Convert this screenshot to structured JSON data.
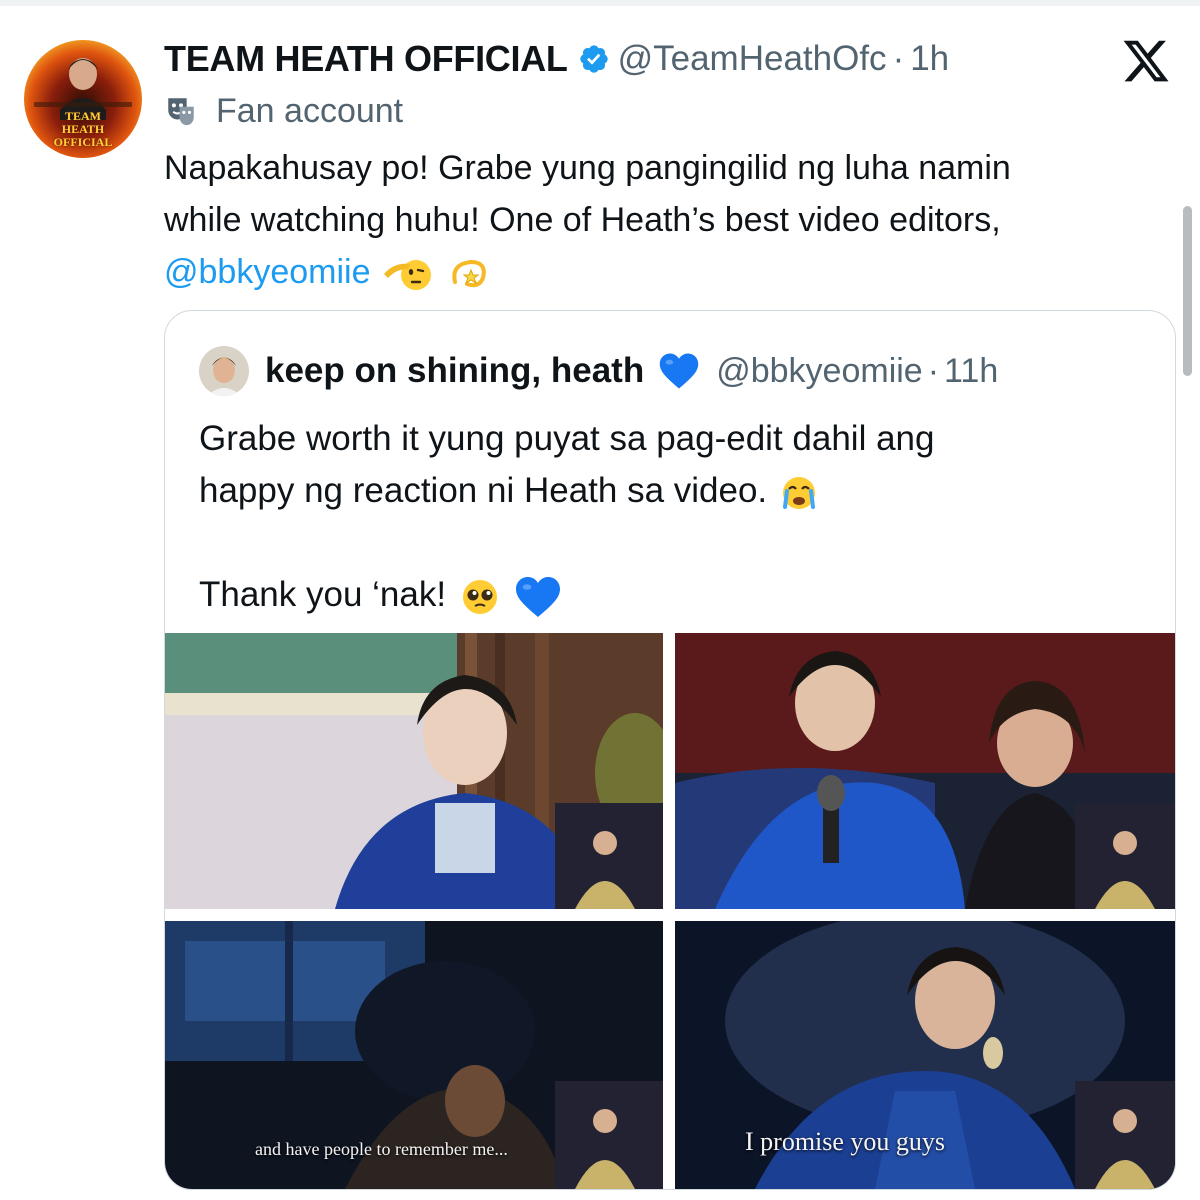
{
  "tweet": {
    "display_name": "TEAM HEATH OFFICIAL",
    "handle": "@TeamHeathOfc",
    "separator": "·",
    "time": "1h",
    "account_label": "Fan account",
    "avatar_text": "TEAM HEATH OFFICIAL",
    "text_lines": [
      "Napakahusay po! Grabe yung pangingilid ng luha namin",
      "while watching huhu! One of Heath’s best video editors,"
    ],
    "mention": "@bbkyeomiie",
    "icons": [
      "verified-badge-icon",
      "fan-account-mask-icon",
      "x-logo-icon",
      "saluting-face-emoji",
      "dizzy-emoji"
    ]
  },
  "quoted_tweet": {
    "display_name": "keep on shining, heath",
    "handle": "@bbkyeomiie",
    "separator": "·",
    "time": "11h",
    "text_lines": [
      "Grabe worth it yung puyat sa pag-edit dahil ang",
      "happy ng reaction ni Heath sa video.",
      "",
      "Thank you ‘nak!"
    ],
    "icons": [
      "blue-heart-emoji",
      "loudly-crying-emoji",
      "pleading-face-emoji"
    ],
    "media_captions": [
      "and have people to remember me...",
      "I promise you guys"
    ]
  },
  "colors": {
    "text": "#0f1419",
    "secondary": "#536471",
    "link": "#1d9bf0",
    "border": "#cfd9de",
    "verified": "#1d9bf0",
    "heart": "#1877f2"
  }
}
